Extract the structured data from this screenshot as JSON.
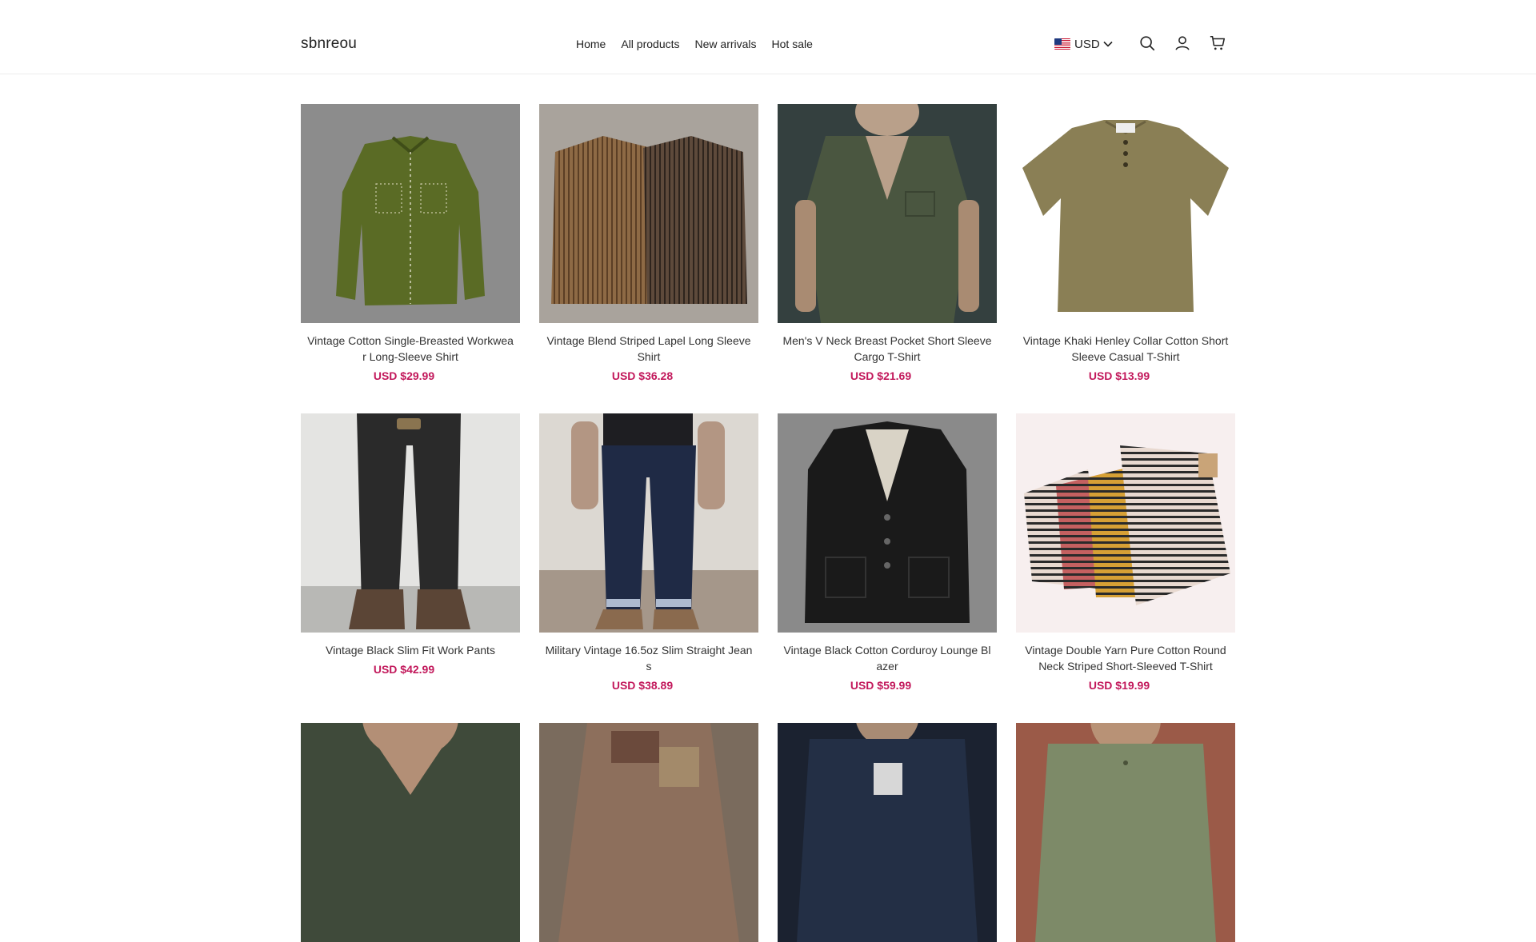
{
  "store": {
    "name": "sbnreou"
  },
  "nav": [
    {
      "label": "Home"
    },
    {
      "label": "All products"
    },
    {
      "label": "New arrivals"
    },
    {
      "label": "Hot sale"
    }
  ],
  "currency": {
    "code": "USD",
    "flag": "us-flag-icon"
  },
  "icons": {
    "search": "search-icon",
    "account": "user-icon",
    "cart": "cart-icon"
  },
  "colors": {
    "price": "#c2185b",
    "header_border": "#ececec"
  },
  "products": [
    {
      "title": "Vintage Cotton Single-Breasted Workwear Long-Sleeve Shirt",
      "price": "USD $29.99"
    },
    {
      "title": "Vintage Blend Striped Lapel Long Sleeve Shirt",
      "price": "USD $36.28"
    },
    {
      "title": "Men's V Neck Breast Pocket Short Sleeve Cargo T-Shirt",
      "price": "USD $21.69"
    },
    {
      "title": "Vintage Khaki Henley Collar Cotton Short Sleeve Casual T-Shirt",
      "price": "USD $13.99"
    },
    {
      "title": "Vintage Black Slim Fit Work Pants",
      "price": "USD $42.99"
    },
    {
      "title": "Military Vintage 16.5oz Slim Straight Jeans",
      "price": "USD $38.89"
    },
    {
      "title": "Vintage Black Cotton Corduroy Lounge Blazer",
      "price": "USD $59.99"
    },
    {
      "title": "Vintage Double Yarn Pure Cotton Round Neck Striped Short-Sleeved T-Shirt",
      "price": "USD $19.99"
    }
  ]
}
